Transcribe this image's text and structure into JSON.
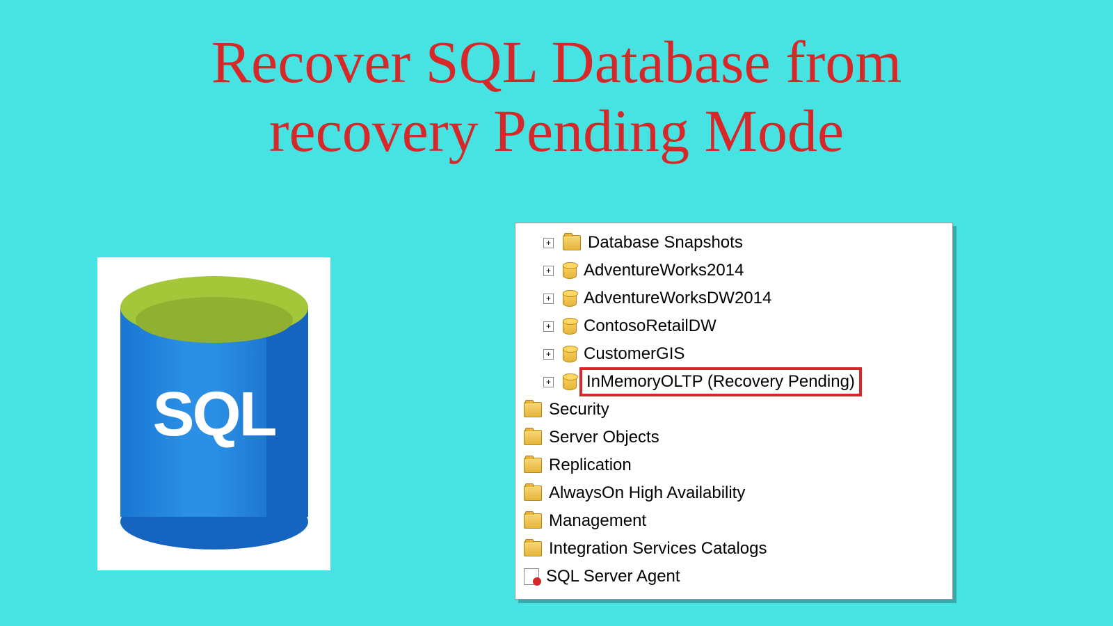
{
  "title_line1": "Recover SQL Database from",
  "title_line2": "recovery Pending Mode",
  "sql_logo_text": "SQL",
  "tree": {
    "items": [
      {
        "level": 1,
        "expander": "+",
        "icon": "folder",
        "label": "Database Snapshots",
        "highlighted": false
      },
      {
        "level": 1,
        "expander": "+",
        "icon": "db",
        "label": "AdventureWorks2014",
        "highlighted": false
      },
      {
        "level": 1,
        "expander": "+",
        "icon": "db",
        "label": "AdventureWorksDW2014",
        "highlighted": false
      },
      {
        "level": 1,
        "expander": "+",
        "icon": "db",
        "label": "ContosoRetailDW",
        "highlighted": false
      },
      {
        "level": 1,
        "expander": "+",
        "icon": "db",
        "label": "CustomerGIS",
        "highlighted": false
      },
      {
        "level": 1,
        "expander": "+",
        "icon": "db",
        "label": "InMemoryOLTP (Recovery Pending)",
        "highlighted": true
      },
      {
        "level": 0,
        "expander": "",
        "icon": "folder",
        "label": "Security",
        "highlighted": false
      },
      {
        "level": 0,
        "expander": "",
        "icon": "folder",
        "label": "Server Objects",
        "highlighted": false
      },
      {
        "level": 0,
        "expander": "",
        "icon": "folder",
        "label": "Replication",
        "highlighted": false
      },
      {
        "level": 0,
        "expander": "",
        "icon": "folder",
        "label": "AlwaysOn High Availability",
        "highlighted": false
      },
      {
        "level": 0,
        "expander": "",
        "icon": "folder",
        "label": "Management",
        "highlighted": false
      },
      {
        "level": 0,
        "expander": "",
        "icon": "folder",
        "label": "Integration Services Catalogs",
        "highlighted": false
      },
      {
        "level": 0,
        "expander": "",
        "icon": "agent",
        "label": "SQL Server Agent",
        "highlighted": false
      }
    ]
  }
}
